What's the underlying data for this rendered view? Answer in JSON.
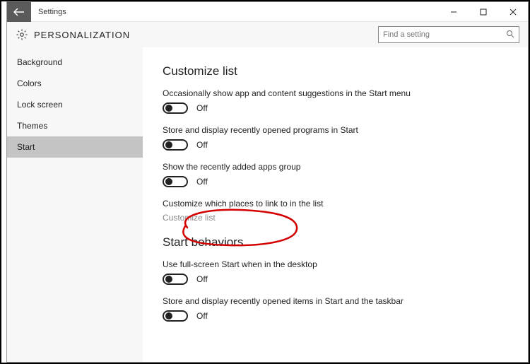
{
  "titlebar": {
    "title": "Settings"
  },
  "header": {
    "section": "PERSONALIZATION",
    "search_placeholder": "Find a setting"
  },
  "sidebar": {
    "items": [
      {
        "label": "Background"
      },
      {
        "label": "Colors"
      },
      {
        "label": "Lock screen"
      },
      {
        "label": "Themes"
      },
      {
        "label": "Start"
      }
    ]
  },
  "content": {
    "group1": {
      "title": "Customize list",
      "s1": {
        "label": "Occasionally show app and content suggestions in the Start menu",
        "state": "Off"
      },
      "s2": {
        "label": "Store and display recently opened programs in Start",
        "state": "Off"
      },
      "s3": {
        "label": "Show the recently added apps group",
        "state": "Off"
      },
      "s4": {
        "label": "Customize which places to link to in the list",
        "link": "Customize list"
      }
    },
    "group2": {
      "title": "Start behaviors",
      "s1": {
        "label": "Use full-screen Start when in the desktop",
        "state": "Off"
      },
      "s2": {
        "label": "Store and display recently opened items in Start and the taskbar",
        "state": "Off"
      }
    }
  }
}
